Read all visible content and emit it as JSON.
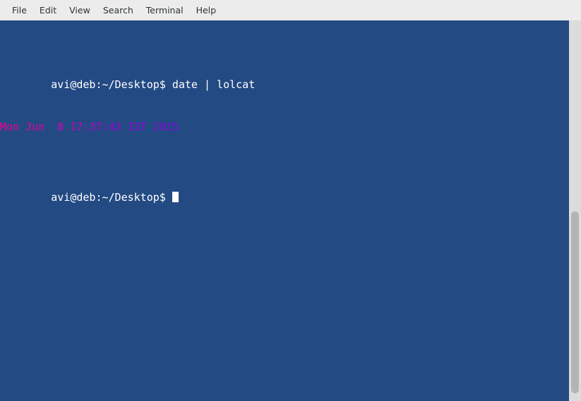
{
  "window": {
    "title": "Terminal",
    "menubar_bg": "#ececec",
    "menu_text_color": "#2e3436"
  },
  "menubar": {
    "items": [
      {
        "label": "File",
        "name": "menu-file"
      },
      {
        "label": "Edit",
        "name": "menu-edit"
      },
      {
        "label": "View",
        "name": "menu-view"
      },
      {
        "label": "Search",
        "name": "menu-search"
      },
      {
        "label": "Terminal",
        "name": "menu-terminal"
      },
      {
        "label": "Help",
        "name": "menu-help"
      }
    ]
  },
  "terminal": {
    "background": "#234a83",
    "foreground": "#ffffff",
    "font_size_px": 15,
    "line_height_px": 20,
    "lines": [
      {
        "type": "command",
        "prompt": "avi@deb:~/Desktop$ ",
        "command": "date | lolcat",
        "full_text": "avi@deb:~/Desktop$ date | lolcat"
      },
      {
        "type": "lolcat-output",
        "full_text": "Mon Jun  8 17:37:43 IST 2015",
        "segments": [
          {
            "text": "M",
            "color": "#f4008c"
          },
          {
            "text": "o",
            "color": "#f2008f"
          },
          {
            "text": "n",
            "color": "#f00093"
          },
          {
            "text": " ",
            "color": "#ee0097"
          },
          {
            "text": "J",
            "color": "#eb009b"
          },
          {
            "text": "u",
            "color": "#e8009f"
          },
          {
            "text": "n",
            "color": "#e400a4"
          },
          {
            "text": " ",
            "color": "#e000a8"
          },
          {
            "text": " ",
            "color": "#dc00ad"
          },
          {
            "text": "8",
            "color": "#d700b2"
          },
          {
            "text": " ",
            "color": "#d200b7"
          },
          {
            "text": "1",
            "color": "#cc00bc"
          },
          {
            "text": "7",
            "color": "#c600c1"
          },
          {
            "text": ":",
            "color": "#c000c6"
          },
          {
            "text": "3",
            "color": "#b900cb"
          },
          {
            "text": "7",
            "color": "#b200cf"
          },
          {
            "text": ":",
            "color": "#ab00d3"
          },
          {
            "text": "4",
            "color": "#a400d7"
          },
          {
            "text": "3",
            "color": "#9d00da"
          },
          {
            "text": " ",
            "color": "#9a00dc"
          },
          {
            "text": "I",
            "color": "#9800dd"
          },
          {
            "text": "S",
            "color": "#9500de"
          },
          {
            "text": "T",
            "color": "#9200df"
          },
          {
            "text": " ",
            "color": "#9000e0"
          },
          {
            "text": "2",
            "color": "#8e00e0"
          },
          {
            "text": "0",
            "color": "#8c00e1"
          },
          {
            "text": "1",
            "color": "#8a00e1"
          },
          {
            "text": "5",
            "color": "#8800e2"
          }
        ]
      },
      {
        "type": "prompt",
        "prompt": "avi@deb:~/Desktop$ ",
        "command": "",
        "full_text": "avi@deb:~/Desktop$ ",
        "cursor": true
      }
    ]
  },
  "scrollbar": {
    "track_color": "#dcdcdc",
    "thumb_color": "#b4b4b4",
    "orientation": "vertical"
  }
}
